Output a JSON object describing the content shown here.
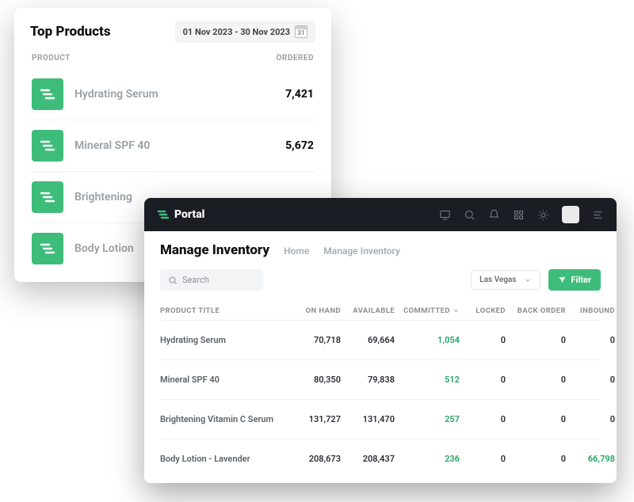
{
  "top_products": {
    "title": "Top Products",
    "date_range": "01 Nov 2023 - 30 Nov 2023",
    "calendar_day": "31",
    "columns": {
      "product": "PRODUCT",
      "ordered": "ORDERED"
    },
    "rows": [
      {
        "name": "Hydrating Serum",
        "ordered": "7,421"
      },
      {
        "name": "Mineral SPF 40",
        "ordered": "5,672"
      },
      {
        "name": "Brightening",
        "ordered": ""
      },
      {
        "name": "Body Lotion",
        "ordered": ""
      }
    ]
  },
  "portal": {
    "brand": "Portal",
    "page_title": "Manage Inventory",
    "breadcrumbs": {
      "home": "Home",
      "current": "Manage Inventory"
    },
    "search_placeholder": "Search",
    "location_selected": "Las Vegas",
    "filter_label": "Filter",
    "columns": {
      "title": "PRODUCT TITLE",
      "on_hand": "ON HAND",
      "available": "AVAILABLE",
      "committed": "COMMITTED",
      "locked": "LOCKED",
      "back_order": "BACK ORDER",
      "inbound": "INBOUND"
    },
    "rows": [
      {
        "title": "Hydrating Serum",
        "on_hand": "70,718",
        "available": "69,664",
        "committed": "1,054",
        "locked": "0",
        "back_order": "0",
        "inbound": "0",
        "inbound_accent": false
      },
      {
        "title": "Mineral SPF 40",
        "on_hand": "80,350",
        "available": "79,838",
        "committed": "512",
        "locked": "0",
        "back_order": "0",
        "inbound": "0",
        "inbound_accent": false
      },
      {
        "title": "Brightening Vitamin C Serum",
        "on_hand": "131,727",
        "available": "131,470",
        "committed": "257",
        "locked": "0",
        "back_order": "0",
        "inbound": "0",
        "inbound_accent": false
      },
      {
        "title": "Body Lotion - Lavender",
        "on_hand": "208,673",
        "available": "208,437",
        "committed": "236",
        "locked": "0",
        "back_order": "0",
        "inbound": "66,798",
        "inbound_accent": true
      }
    ]
  }
}
